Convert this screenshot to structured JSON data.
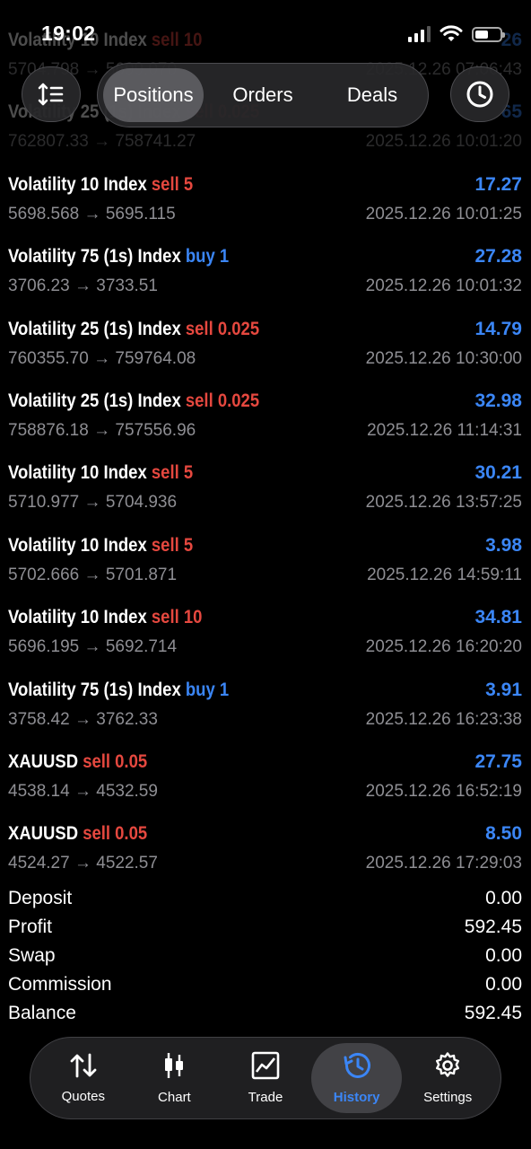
{
  "status": {
    "time": "19:02"
  },
  "toolbar": {
    "tabs": [
      "Positions",
      "Orders",
      "Deals"
    ],
    "active_tab": "Positions"
  },
  "deals": [
    {
      "symbol": "Volatility 10 Index",
      "side": "sell",
      "volume": "10",
      "open": "5704.798",
      "close": "5699.070",
      "time": "2025.12.26 07:06:43",
      "profit": "26"
    },
    {
      "symbol": "Volatility 25 (1s) Index",
      "side": "sell",
      "volume": "0.025",
      "open": "762807.33",
      "close": "758741.27",
      "time": "2025.12.26 10:01:20",
      "profit": "65"
    },
    {
      "symbol": "Volatility 10 Index",
      "side": "sell",
      "volume": "5",
      "open": "5698.568",
      "close": "5695.115",
      "time": "2025.12.26 10:01:25",
      "profit": "17.27"
    },
    {
      "symbol": "Volatility 75 (1s) Index",
      "side": "buy",
      "volume": "1",
      "open": "3706.23",
      "close": "3733.51",
      "time": "2025.12.26 10:01:32",
      "profit": "27.28"
    },
    {
      "symbol": "Volatility 25 (1s) Index",
      "side": "sell",
      "volume": "0.025",
      "open": "760355.70",
      "close": "759764.08",
      "time": "2025.12.26 10:30:00",
      "profit": "14.79"
    },
    {
      "symbol": "Volatility 25 (1s) Index",
      "side": "sell",
      "volume": "0.025",
      "open": "758876.18",
      "close": "757556.96",
      "time": "2025.12.26 11:14:31",
      "profit": "32.98"
    },
    {
      "symbol": "Volatility 10 Index",
      "side": "sell",
      "volume": "5",
      "open": "5710.977",
      "close": "5704.936",
      "time": "2025.12.26 13:57:25",
      "profit": "30.21"
    },
    {
      "symbol": "Volatility 10 Index",
      "side": "sell",
      "volume": "5",
      "open": "5702.666",
      "close": "5701.871",
      "time": "2025.12.26 14:59:11",
      "profit": "3.98"
    },
    {
      "symbol": "Volatility 10 Index",
      "side": "sell",
      "volume": "10",
      "open": "5696.195",
      "close": "5692.714",
      "time": "2025.12.26 16:20:20",
      "profit": "34.81"
    },
    {
      "symbol": "Volatility 75 (1s) Index",
      "side": "buy",
      "volume": "1",
      "open": "3758.42",
      "close": "3762.33",
      "time": "2025.12.26 16:23:38",
      "profit": "3.91"
    },
    {
      "symbol": "XAUUSD",
      "side": "sell",
      "volume": "0.05",
      "open": "4538.14",
      "close": "4532.59",
      "time": "2025.12.26 16:52:19",
      "profit": "27.75"
    },
    {
      "symbol": "XAUUSD",
      "side": "sell",
      "volume": "0.05",
      "open": "4524.27",
      "close": "4522.57",
      "time": "2025.12.26 17:29:03",
      "profit": "8.50"
    }
  ],
  "summary": [
    {
      "label": "Deposit",
      "value": "0.00"
    },
    {
      "label": "Profit",
      "value": "592.45"
    },
    {
      "label": "Swap",
      "value": "0.00"
    },
    {
      "label": "Commission",
      "value": "0.00"
    },
    {
      "label": "Balance",
      "value": "592.45"
    }
  ],
  "nav": [
    {
      "label": "Quotes",
      "icon": "quotes-arrows-icon"
    },
    {
      "label": "Chart",
      "icon": "candlestick-icon"
    },
    {
      "label": "Trade",
      "icon": "trade-chart-icon"
    },
    {
      "label": "History",
      "icon": "history-clock-icon",
      "active": true
    },
    {
      "label": "Settings",
      "icon": "gear-icon"
    }
  ],
  "colors": {
    "sell": "#e5483f",
    "buy": "#3b86f6",
    "profit": "#3b86f6",
    "muted": "#8e8e93"
  }
}
